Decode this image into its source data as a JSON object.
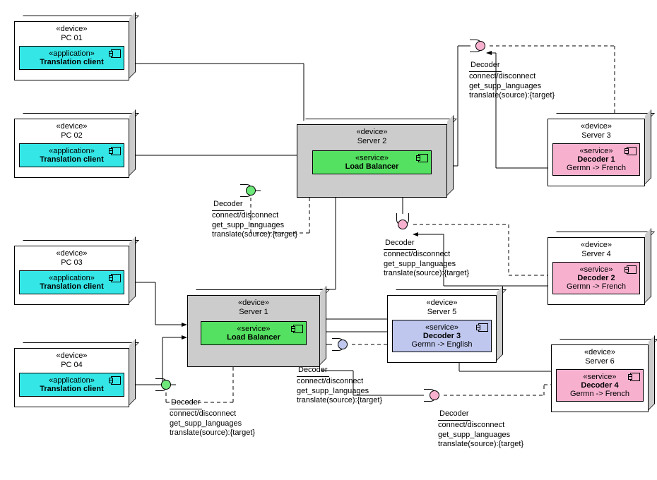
{
  "stereotypes": {
    "device": "«device»",
    "application": "«application»",
    "service": "«service»"
  },
  "pcs": [
    {
      "name": "PC 01",
      "comp": "Translation client"
    },
    {
      "name": "PC 02",
      "comp": "Translation client"
    },
    {
      "name": "PC 03",
      "comp": "Translation client"
    },
    {
      "name": "PC 04",
      "comp": "Translation client"
    }
  ],
  "servers": {
    "s1": {
      "name": "Server 1",
      "comp": "Load Balancer"
    },
    "s2": {
      "name": "Server 2",
      "comp": "Load Balancer"
    },
    "s3": {
      "name": "Server 3",
      "comp": "Decoder 1",
      "sub": "Germn -> French"
    },
    "s4": {
      "name": "Server 4",
      "comp": "Decoder 2",
      "sub": "Germn -> French"
    },
    "s5": {
      "name": "Server 5",
      "comp": "Decoder 3",
      "sub": "Germn -> English"
    },
    "s6": {
      "name": "Server 6",
      "comp": "Decoder 4",
      "sub": "Germn -> French"
    }
  },
  "iface": {
    "title": "Decoder",
    "ops": [
      "connect/disconnect",
      "get_supp_languages",
      "translate(source):{target}"
    ]
  }
}
